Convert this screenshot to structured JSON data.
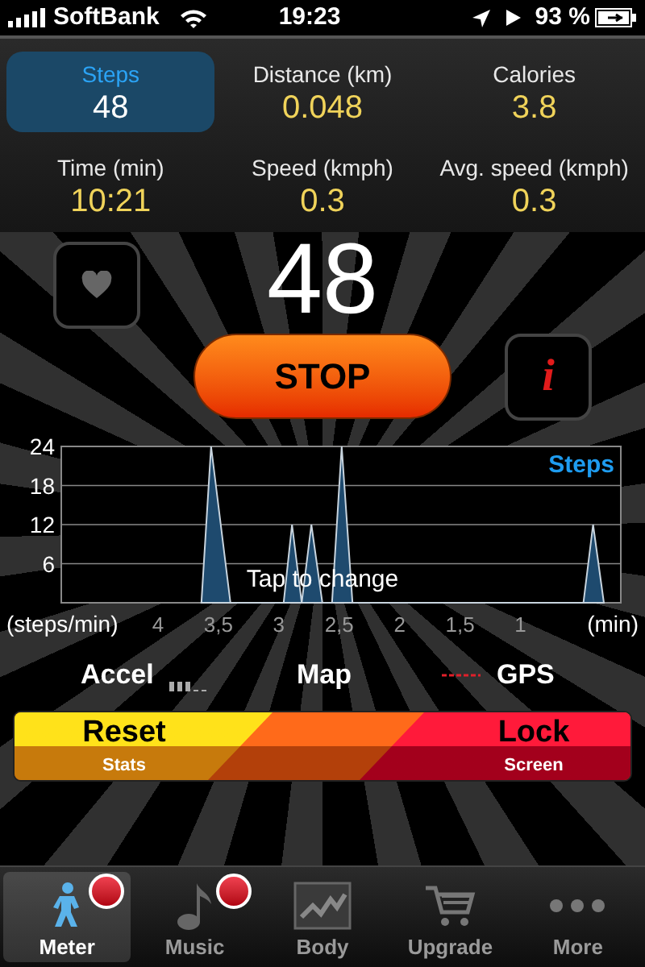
{
  "status_bar": {
    "carrier": "SoftBank",
    "time": "19:23",
    "battery": "93 %"
  },
  "stats": [
    {
      "label": "Steps",
      "value": "48",
      "selected": true
    },
    {
      "label": "Distance (km)",
      "value": "0.048",
      "selected": false
    },
    {
      "label": "Calories",
      "value": "3.8",
      "selected": false
    },
    {
      "label": "Time (min)",
      "value": "10:21",
      "selected": false
    },
    {
      "label": "Speed (kmph)",
      "value": "0.3",
      "selected": false
    },
    {
      "label": "Avg. speed (kmph)",
      "value": "0.3",
      "selected": false
    }
  ],
  "counter": "48",
  "stop_button": "STOP",
  "info_button": "i",
  "chart": {
    "hint": "Tap to change",
    "chart_data": {
      "type": "area",
      "xlabel": "(min)",
      "ylabel": "(steps/min)",
      "x": [
        3.64,
        3.56,
        3.4,
        2.96,
        2.89,
        2.81,
        2.73,
        2.64,
        2.56,
        2.48,
        2.39,
        0.48,
        0.4,
        0.31
      ],
      "series": [
        {
          "name": "Steps",
          "color": "#1e4a6e",
          "values": [
            0,
            24,
            0,
            0,
            12,
            0,
            12,
            0,
            0,
            24,
            0,
            0,
            12,
            0
          ]
        }
      ],
      "xlim": [
        4.8,
        0.17
      ],
      "ylim": [
        0,
        24
      ],
      "xticks": [
        {
          "value": 4,
          "label": "4"
        },
        {
          "value": 3.5,
          "label": "3,5"
        },
        {
          "value": 3,
          "label": "3"
        },
        {
          "value": 2.5,
          "label": "2,5"
        },
        {
          "value": 2,
          "label": "2"
        },
        {
          "value": 1.5,
          "label": "1,5"
        },
        {
          "value": 1,
          "label": "1"
        }
      ],
      "yticks": [
        6,
        12,
        18,
        24
      ],
      "grid": true
    }
  },
  "sensors": [
    {
      "kind": "accel",
      "label": "Accel"
    },
    {
      "kind": "map",
      "label": "Map"
    },
    {
      "kind": "gps",
      "label": "GPS"
    }
  ],
  "actions": [
    {
      "kind": "reset",
      "title": "Reset",
      "subtitle": "Stats"
    },
    {
      "kind": "lock",
      "title": "Lock",
      "subtitle": "Screen"
    }
  ],
  "tabs": [
    {
      "kind": "meter",
      "label": "Meter",
      "selected": true,
      "badge": true
    },
    {
      "kind": "music",
      "label": "Music",
      "selected": false,
      "badge": true
    },
    {
      "kind": "body",
      "label": "Body",
      "selected": false,
      "badge": false
    },
    {
      "kind": "upgrade",
      "label": "Upgrade",
      "selected": false,
      "badge": false
    },
    {
      "kind": "more",
      "label": "More",
      "selected": false,
      "badge": false
    }
  ]
}
